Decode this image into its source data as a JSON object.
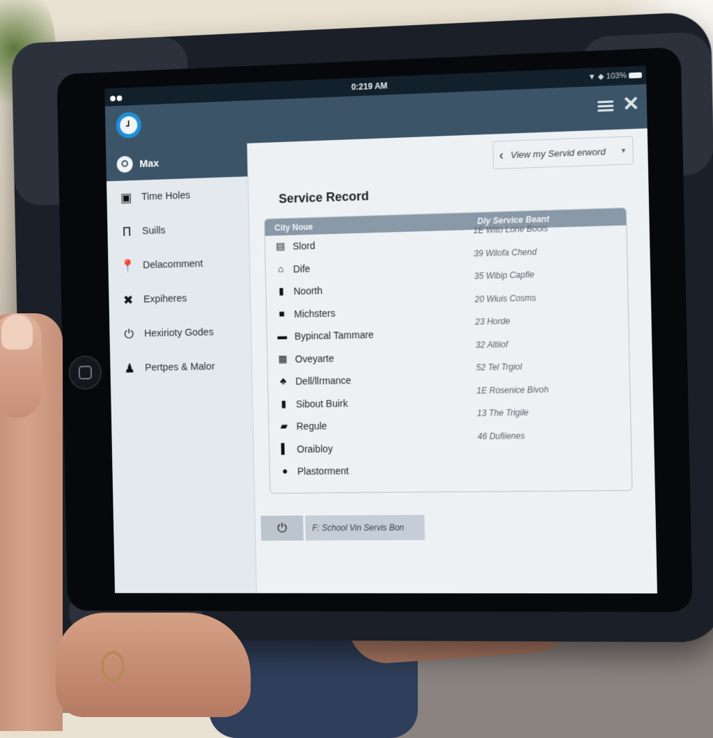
{
  "statusbar": {
    "time": "0:219 AM",
    "right_indicators": "▼ ◆ 103%"
  },
  "appbar": {
    "logo_icon": "clock-icon",
    "menu_icon": "hamburger-menu-icon",
    "close_label": "✕"
  },
  "sidebar": {
    "active": {
      "label": "Max",
      "icon": "map-pin-icon"
    },
    "items": [
      {
        "label": "Time Holes",
        "icon": "▣",
        "icon_name": "garage-icon"
      },
      {
        "label": "Suills",
        "icon": "Π",
        "icon_name": "tool-icon"
      },
      {
        "label": "Delacomment",
        "icon": "⬤",
        "icon_name": "location-pin-icon"
      },
      {
        "label": "Expiheres",
        "icon": "✖",
        "icon_name": "cross-tools-icon"
      },
      {
        "label": "Hexirioty Godes",
        "icon": "⏻",
        "icon_name": "power-icon"
      },
      {
        "label": "Pertpes & Malor",
        "icon": "♟",
        "icon_name": "person-icon"
      }
    ]
  },
  "main": {
    "view_dropdown": {
      "label": "View my Servid erword",
      "back_icon": "‹",
      "caret": "▼"
    },
    "title": "Service Record",
    "table": {
      "headers": [
        "City Noue",
        "Dly Service Beant"
      ],
      "rows": [
        {
          "name": "Slord",
          "icon": "▤",
          "value": "1E Wito Lone Boois"
        },
        {
          "name": "Dife",
          "icon": "⌂",
          "value": "39 Wilofa Chend"
        },
        {
          "name": "Noorth",
          "icon": "▮",
          "value": "35 Wibip Capfle"
        },
        {
          "name": "Michsters",
          "icon": "■",
          "value": "20 Wiuis Cosms"
        },
        {
          "name": "Bypincal Tammare",
          "icon": "▬",
          "value": "23 Horde"
        },
        {
          "name": "Oveyarte",
          "icon": "▦",
          "value": "32 Altiiof"
        },
        {
          "name": "Dell/llrmance",
          "icon": "♣",
          "value": "52 Tel Trgiol"
        },
        {
          "name": "Sibout Buirk",
          "icon": "▮",
          "value": "1E Rosenice Bivoh"
        },
        {
          "name": "Regule",
          "icon": "▰",
          "value": "13 The Trigile"
        },
        {
          "name": "Oraibloy",
          "icon": "▌",
          "value": "46 Dufiienes"
        },
        {
          "name": "Plastorment",
          "icon": "●",
          "value": ""
        }
      ]
    },
    "footer": {
      "icon": "⏻",
      "label": "F: School Vin Servis Bon"
    }
  }
}
